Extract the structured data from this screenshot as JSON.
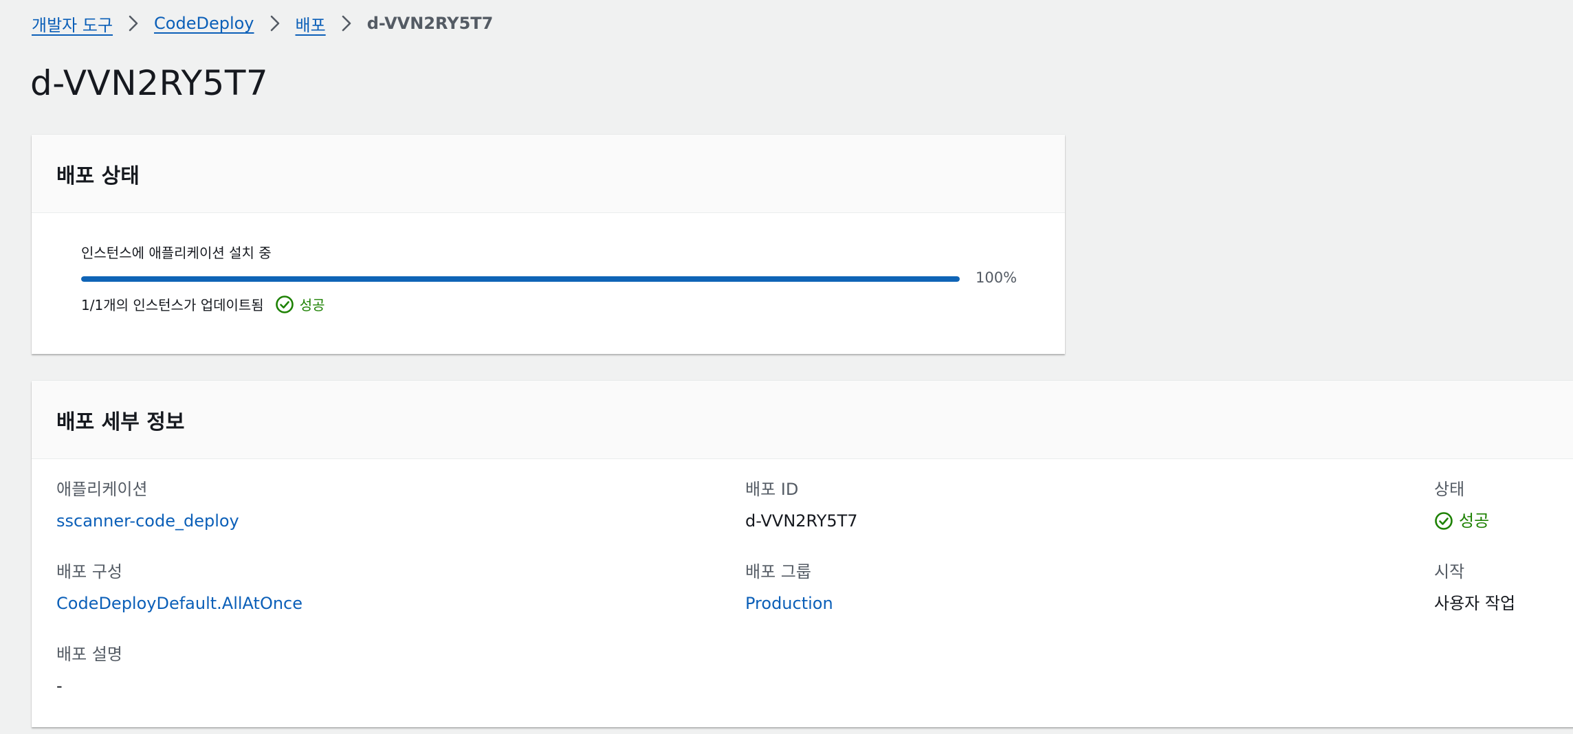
{
  "breadcrumb": {
    "items": [
      "개발자 도구",
      "CodeDeploy",
      "배포"
    ],
    "current": "d-VVN2RY5T7"
  },
  "page": {
    "title": "d-VVN2RY5T7"
  },
  "deployment_status": {
    "heading": "배포 상태",
    "progress_label": "인스턴스에 애플리케이션 설치 중",
    "progress_value": 1.0,
    "progress_percent_text": "100%",
    "instances_text": "1/1개의 인스턴스가 업데이트됨",
    "status_text": "성공"
  },
  "deployment_details": {
    "heading": "배포 세부 정보",
    "application": {
      "label": "애플리케이션",
      "value": "sscanner-code_deploy"
    },
    "deployment_id": {
      "label": "배포 ID",
      "value": "d-VVN2RY5T7"
    },
    "status": {
      "label": "상태",
      "value": "성공"
    },
    "deployment_config": {
      "label": "배포 구성",
      "value": "CodeDeployDefault.AllAtOnce"
    },
    "deployment_group": {
      "label": "배포 그룹",
      "value": "Production"
    },
    "initiated": {
      "label": "시작",
      "value": "사용자 작업"
    },
    "description": {
      "label": "배포 설명",
      "value": "-"
    }
  },
  "colors": {
    "link": "#0b5fb8",
    "success": "#1d8102",
    "progress": "#0f64b6",
    "background": "#f0f1f1"
  },
  "icons": {
    "breadcrumb_separator": "chevron-right-icon",
    "status": "status-success-icon"
  }
}
